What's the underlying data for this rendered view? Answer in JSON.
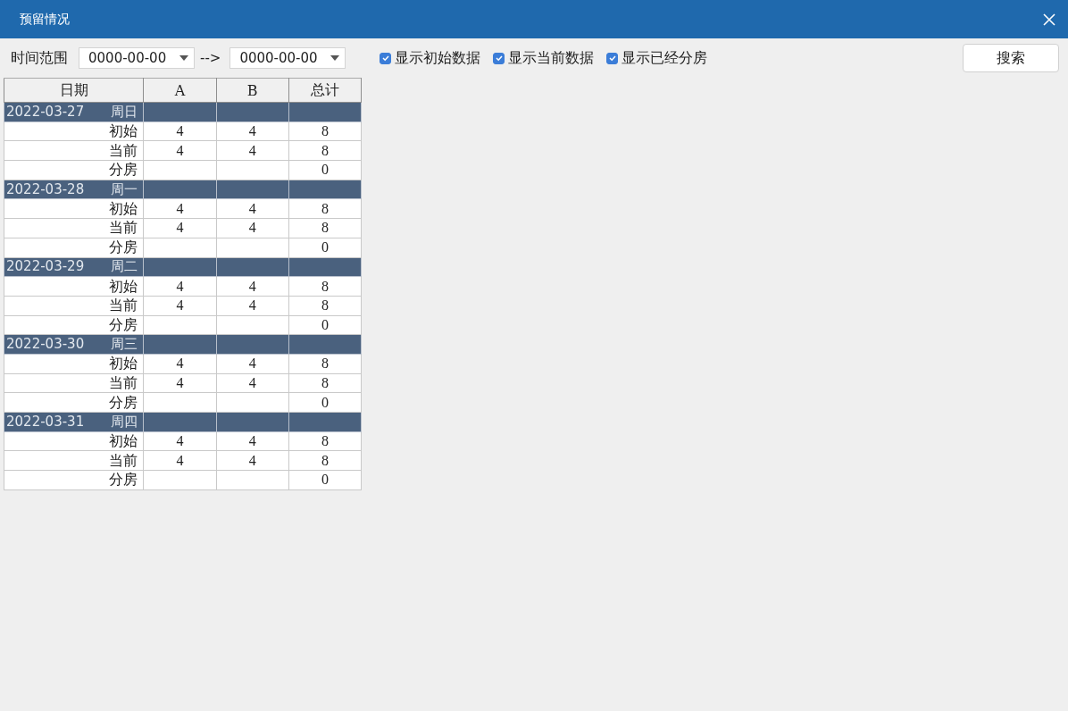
{
  "window": {
    "title": "预留情况"
  },
  "toolbar": {
    "range_label": "时间范围",
    "from": "0000-00-00",
    "arrow": "-->",
    "to": "0000-00-00",
    "checkboxes": [
      {
        "label": "显示初始数据",
        "checked": true
      },
      {
        "label": "显示当前数据",
        "checked": true
      },
      {
        "label": "显示已经分房",
        "checked": true
      }
    ],
    "search_button": "搜索"
  },
  "table": {
    "columns": [
      "日期",
      "A",
      "B",
      "总计"
    ],
    "groups": [
      {
        "date": "2022-03-27",
        "weekday": "周日",
        "rows": [
          {
            "label": "初始",
            "a": "4",
            "b": "4",
            "total": "8"
          },
          {
            "label": "当前",
            "a": "4",
            "b": "4",
            "total": "8"
          },
          {
            "label": "分房",
            "total": "0"
          }
        ]
      },
      {
        "date": "2022-03-28",
        "weekday": "周一",
        "rows": [
          {
            "label": "初始",
            "a": "4",
            "b": "4",
            "total": "8"
          },
          {
            "label": "当前",
            "a": "4",
            "b": "4",
            "total": "8"
          },
          {
            "label": "分房",
            "total": "0"
          }
        ]
      },
      {
        "date": "2022-03-29",
        "weekday": "周二",
        "rows": [
          {
            "label": "初始",
            "a": "4",
            "b": "4",
            "total": "8"
          },
          {
            "label": "当前",
            "a": "4",
            "b": "4",
            "total": "8"
          },
          {
            "label": "分房",
            "total": "0"
          }
        ]
      },
      {
        "date": "2022-03-30",
        "weekday": "周三",
        "rows": [
          {
            "label": "初始",
            "a": "4",
            "b": "4",
            "total": "8"
          },
          {
            "label": "当前",
            "a": "4",
            "b": "4",
            "total": "8"
          },
          {
            "label": "分房",
            "total": "0"
          }
        ]
      },
      {
        "date": "2022-03-31",
        "weekday": "周四",
        "rows": [
          {
            "label": "初始",
            "a": "4",
            "b": "4",
            "total": "8"
          },
          {
            "label": "当前",
            "a": "4",
            "b": "4",
            "total": "8"
          },
          {
            "label": "分房",
            "total": "0"
          }
        ]
      }
    ]
  }
}
